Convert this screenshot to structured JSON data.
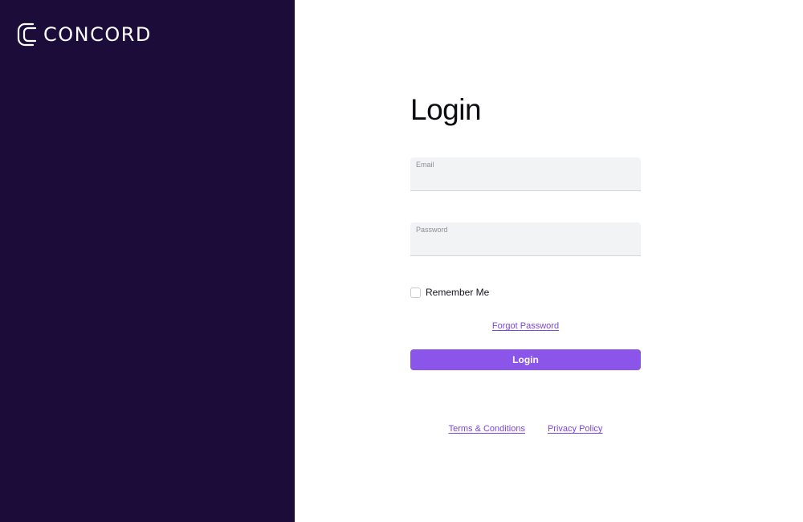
{
  "brand": {
    "name": "CONCORD",
    "panel_color": "#1b0c3a",
    "logo_icon": "concord-c-logo-icon"
  },
  "login": {
    "title": "Login",
    "email_label": "Email",
    "email_value": "",
    "password_label": "Password",
    "password_value": "",
    "remember_label": "Remember Me",
    "remember_checked": false,
    "forgot_label": "Forgot Password",
    "submit_label": "Login",
    "accent_color": "#8b55ea"
  },
  "footer": {
    "terms_label": "Terms & Conditions",
    "privacy_label": "Privacy Policy"
  }
}
